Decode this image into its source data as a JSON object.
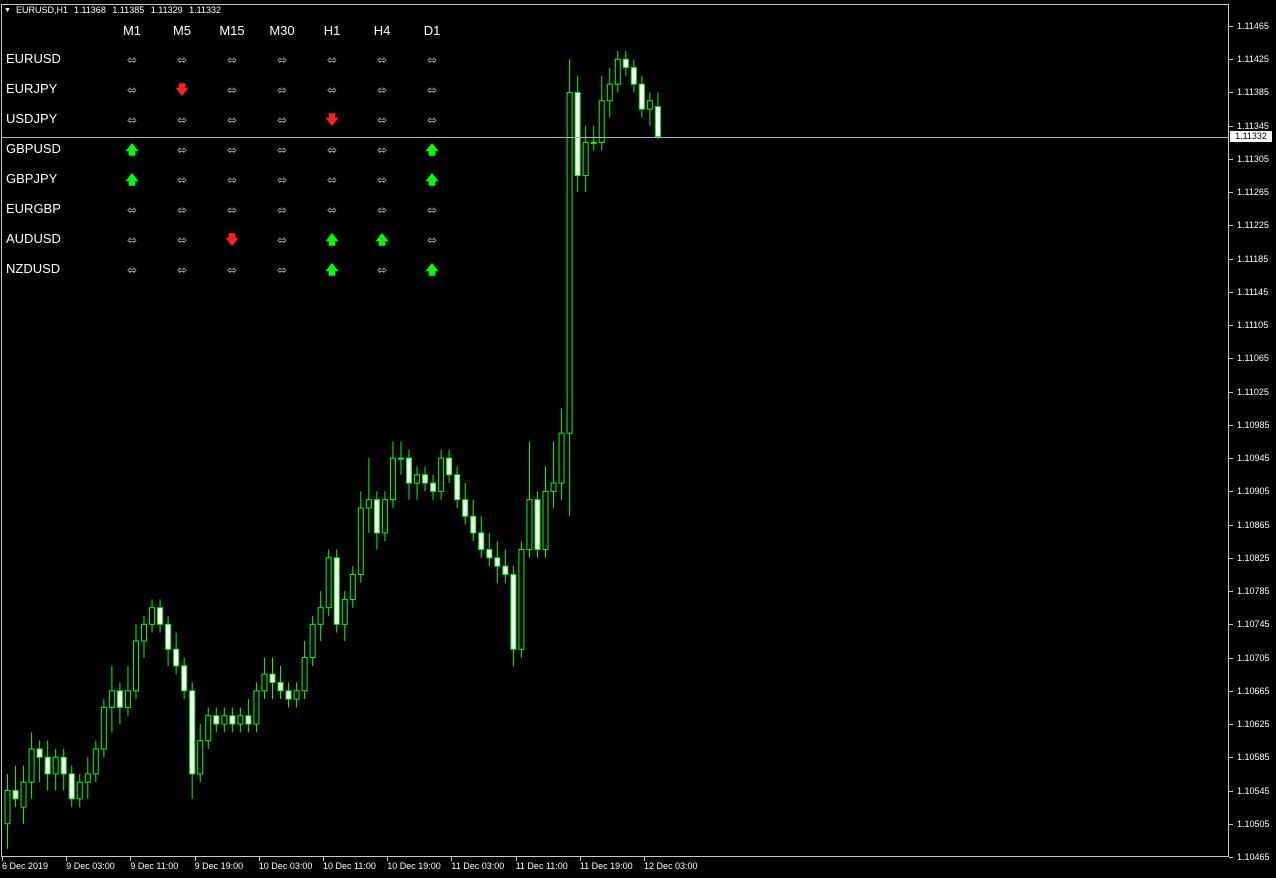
{
  "title": {
    "symbol": "EURUSD,H1",
    "ohlc": [
      "1.11368",
      "1.11385",
      "1.11329",
      "1.11332"
    ]
  },
  "current_price": "1.11332",
  "price_axis": [
    "1.11465",
    "1.11425",
    "1.11385",
    "1.11345",
    "1.11305",
    "1.11265",
    "1.11225",
    "1.11185",
    "1.11145",
    "1.11105",
    "1.11065",
    "1.11025",
    "1.10985",
    "1.10945",
    "1.10905",
    "1.10865",
    "1.10825",
    "1.10785",
    "1.10745",
    "1.10705",
    "1.10665",
    "1.10625",
    "1.10585",
    "1.10545",
    "1.10505",
    "1.10465"
  ],
  "time_axis": [
    "6 Dec 2019",
    "9 Dec 03:00",
    "9 Dec 11:00",
    "9 Dec 19:00",
    "10 Dec 03:00",
    "10 Dec 11:00",
    "10 Dec 19:00",
    "11 Dec 03:00",
    "11 Dec 11:00",
    "11 Dec 19:00",
    "12 Dec 03:00"
  ],
  "timeframes": [
    "M1",
    "M5",
    "M15",
    "M30",
    "H1",
    "H4",
    "D1"
  ],
  "signals": [
    {
      "symbol": "EURUSD",
      "values": [
        "neutral",
        "neutral",
        "neutral",
        "neutral",
        "neutral",
        "neutral",
        "neutral"
      ]
    },
    {
      "symbol": "EURJPY",
      "values": [
        "neutral",
        "down",
        "neutral",
        "neutral",
        "neutral",
        "neutral",
        "neutral"
      ]
    },
    {
      "symbol": "USDJPY",
      "values": [
        "neutral",
        "neutral",
        "neutral",
        "neutral",
        "down",
        "neutral",
        "neutral"
      ]
    },
    {
      "symbol": "GBPUSD",
      "values": [
        "up",
        "neutral",
        "neutral",
        "neutral",
        "neutral",
        "neutral",
        "up"
      ]
    },
    {
      "symbol": "GBPJPY",
      "values": [
        "up",
        "neutral",
        "neutral",
        "neutral",
        "neutral",
        "neutral",
        "up"
      ]
    },
    {
      "symbol": "EURGBP",
      "values": [
        "neutral",
        "neutral",
        "neutral",
        "neutral",
        "neutral",
        "neutral",
        "neutral"
      ]
    },
    {
      "symbol": "AUDUSD",
      "values": [
        "neutral",
        "neutral",
        "down",
        "neutral",
        "up",
        "up",
        "neutral"
      ]
    },
    {
      "symbol": "NZDUSD",
      "values": [
        "neutral",
        "neutral",
        "neutral",
        "neutral",
        "up",
        "neutral",
        "up"
      ]
    }
  ],
  "signal_glyphs": {
    "neutral": "⬄",
    "up": "🡅",
    "down": "🡇"
  },
  "colors": {
    "background": "#000000",
    "bull_candle": "#00ff00",
    "bear_candle": "#ffffff",
    "signal_up": "#00ff00",
    "signal_down": "#ff2020",
    "bid_line": "#a6b4c8"
  },
  "chart_data": {
    "type": "candlestick",
    "symbol": "EURUSD",
    "timeframe": "H1",
    "ylim": [
      1.10465,
      1.11465
    ],
    "candles": [
      [
        1.10505,
        1.10565,
        1.10475,
        1.10545
      ],
      [
        1.10545,
        1.10575,
        1.10525,
        1.10535
      ],
      [
        1.10525,
        1.10575,
        1.10505,
        1.10555
      ],
      [
        1.10555,
        1.10615,
        1.10535,
        1.10595
      ],
      [
        1.10595,
        1.10605,
        1.10555,
        1.10585
      ],
      [
        1.10585,
        1.10605,
        1.10545,
        1.10565
      ],
      [
        1.10565,
        1.10595,
        1.10545,
        1.10585
      ],
      [
        1.10585,
        1.10595,
        1.10545,
        1.10565
      ],
      [
        1.10565,
        1.10575,
        1.10525,
        1.10535
      ],
      [
        1.10535,
        1.10565,
        1.10525,
        1.10555
      ],
      [
        1.10555,
        1.10585,
        1.10535,
        1.10565
      ],
      [
        1.10565,
        1.10605,
        1.10555,
        1.10595
      ],
      [
        1.10595,
        1.10655,
        1.10585,
        1.10645
      ],
      [
        1.10645,
        1.10695,
        1.10615,
        1.10665
      ],
      [
        1.10665,
        1.10675,
        1.10625,
        1.10645
      ],
      [
        1.10645,
        1.10695,
        1.10635,
        1.10665
      ],
      [
        1.10665,
        1.10745,
        1.10655,
        1.10725
      ],
      [
        1.10725,
        1.10755,
        1.10705,
        1.10745
      ],
      [
        1.10745,
        1.10775,
        1.10735,
        1.10765
      ],
      [
        1.10765,
        1.10775,
        1.10735,
        1.10745
      ],
      [
        1.10745,
        1.10755,
        1.10695,
        1.10715
      ],
      [
        1.10715,
        1.10735,
        1.10685,
        1.10695
      ],
      [
        1.10695,
        1.10705,
        1.10655,
        1.10665
      ],
      [
        1.10665,
        1.10675,
        1.10535,
        1.10565
      ],
      [
        1.10565,
        1.10625,
        1.10555,
        1.10605
      ],
      [
        1.10605,
        1.10645,
        1.10595,
        1.10635
      ],
      [
        1.10635,
        1.10645,
        1.10615,
        1.10625
      ],
      [
        1.10625,
        1.10645,
        1.10615,
        1.10635
      ],
      [
        1.10635,
        1.10645,
        1.10615,
        1.10625
      ],
      [
        1.10625,
        1.10645,
        1.10615,
        1.10635
      ],
      [
        1.10635,
        1.10655,
        1.10615,
        1.10625
      ],
      [
        1.10625,
        1.10675,
        1.10615,
        1.10665
      ],
      [
        1.10665,
        1.10705,
        1.10655,
        1.10685
      ],
      [
        1.10685,
        1.10705,
        1.10655,
        1.10675
      ],
      [
        1.10675,
        1.10695,
        1.10655,
        1.10665
      ],
      [
        1.10665,
        1.10675,
        1.10645,
        1.10655
      ],
      [
        1.10655,
        1.10675,
        1.10645,
        1.10665
      ],
      [
        1.10665,
        1.10725,
        1.10655,
        1.10705
      ],
      [
        1.10705,
        1.10755,
        1.10695,
        1.10745
      ],
      [
        1.10745,
        1.10785,
        1.10725,
        1.10765
      ],
      [
        1.10765,
        1.10835,
        1.10755,
        1.10825
      ],
      [
        1.10825,
        1.10835,
        1.10735,
        1.10745
      ],
      [
        1.10745,
        1.10785,
        1.10725,
        1.10775
      ],
      [
        1.10775,
        1.10815,
        1.10765,
        1.10805
      ],
      [
        1.10805,
        1.10905,
        1.10795,
        1.10885
      ],
      [
        1.10885,
        1.10945,
        1.10855,
        1.10895
      ],
      [
        1.10895,
        1.10905,
        1.10835,
        1.10855
      ],
      [
        1.10855,
        1.10905,
        1.10845,
        1.10895
      ],
      [
        1.10895,
        1.10965,
        1.10885,
        1.10945
      ],
      [
        1.10945,
        1.10965,
        1.10925,
        1.10945
      ],
      [
        1.10945,
        1.10955,
        1.10895,
        1.10915
      ],
      [
        1.10915,
        1.10935,
        1.10895,
        1.10925
      ],
      [
        1.10925,
        1.10935,
        1.10905,
        1.10915
      ],
      [
        1.10915,
        1.10925,
        1.10895,
        1.10905
      ],
      [
        1.10905,
        1.10955,
        1.10895,
        1.10945
      ],
      [
        1.10945,
        1.10955,
        1.10915,
        1.10925
      ],
      [
        1.10925,
        1.10935,
        1.10885,
        1.10895
      ],
      [
        1.10895,
        1.10915,
        1.10865,
        1.10875
      ],
      [
        1.10875,
        1.10895,
        1.10845,
        1.10855
      ],
      [
        1.10855,
        1.10875,
        1.10825,
        1.10835
      ],
      [
        1.10835,
        1.10855,
        1.10815,
        1.10825
      ],
      [
        1.10825,
        1.10845,
        1.10795,
        1.10815
      ],
      [
        1.10815,
        1.10835,
        1.10795,
        1.10805
      ],
      [
        1.10805,
        1.10815,
        1.10695,
        1.10715
      ],
      [
        1.10715,
        1.10845,
        1.10705,
        1.10835
      ],
      [
        1.10835,
        1.10965,
        1.10825,
        1.10895
      ],
      [
        1.10895,
        1.10905,
        1.10825,
        1.10835
      ],
      [
        1.10835,
        1.10935,
        1.10825,
        1.10905
      ],
      [
        1.10905,
        1.10965,
        1.10885,
        1.10915
      ],
      [
        1.10915,
        1.11005,
        1.10895,
        1.10975
      ],
      [
        1.10975,
        1.11425,
        1.10875,
        1.11385
      ],
      [
        1.11385,
        1.11405,
        1.11265,
        1.11285
      ],
      [
        1.11285,
        1.11345,
        1.11265,
        1.11325
      ],
      [
        1.11325,
        1.11345,
        1.11315,
        1.11325
      ],
      [
        1.11325,
        1.11405,
        1.11315,
        1.11375
      ],
      [
        1.11375,
        1.11415,
        1.11355,
        1.11395
      ],
      [
        1.11395,
        1.11435,
        1.11385,
        1.11425
      ],
      [
        1.11425,
        1.11435,
        1.11405,
        1.11415
      ],
      [
        1.11415,
        1.11425,
        1.11385,
        1.11395
      ],
      [
        1.11395,
        1.11405,
        1.11355,
        1.11365
      ],
      [
        1.11365,
        1.11385,
        1.11345,
        1.11375
      ],
      [
        1.11368,
        1.11385,
        1.11329,
        1.11332
      ]
    ]
  }
}
